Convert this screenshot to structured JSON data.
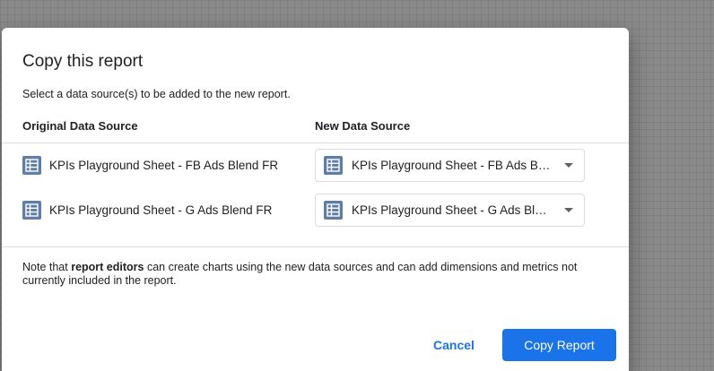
{
  "dialog": {
    "title": "Copy this report",
    "subtitle": "Select a data source(s) to be added to the new report.",
    "columns": {
      "original": "Original Data Source",
      "new": "New Data Source"
    },
    "rows": [
      {
        "original": "KPIs Playground Sheet - FB Ads Blend FR",
        "selected": "KPIs Playground Sheet - FB Ads Blend FR",
        "icon": "sheet-icon"
      },
      {
        "original": "KPIs Playground Sheet - G Ads Blend FR",
        "selected": "KPIs Playground Sheet - G Ads Blend FR",
        "icon": "sheet-icon"
      }
    ],
    "note": {
      "prefix": "Note that ",
      "bold": "report editors",
      "suffix": " can create charts using the new data sources and can add dimensions and metrics not currently included in the report."
    },
    "buttons": {
      "cancel": "Cancel",
      "copy": "Copy Report"
    }
  },
  "colors": {
    "accent": "#1a73e8",
    "icon": "#5f7ea6"
  }
}
